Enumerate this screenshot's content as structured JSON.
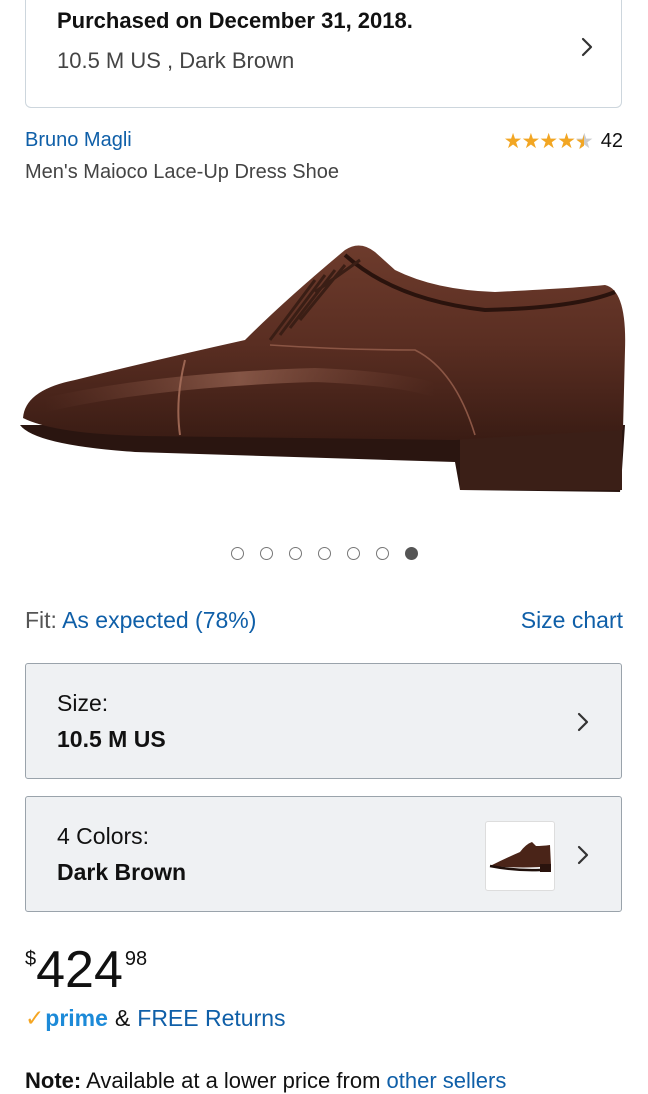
{
  "purchased": {
    "title": "Purchased on December 31, 2018.",
    "detail": "10.5 M US , Dark Brown"
  },
  "product": {
    "brand": "Bruno Magli",
    "title": "Men's Maioco Lace-Up Dress Shoe",
    "rating_count": "42",
    "rating_stars": 4.5
  },
  "carousel": {
    "dot_count": 7,
    "active_index": 6
  },
  "fit": {
    "label": "Fit:",
    "value": "As expected (78%)",
    "size_chart_link": "Size chart"
  },
  "size_selector": {
    "label": "Size:",
    "value": "10.5 M US"
  },
  "color_selector": {
    "label": "4 Colors:",
    "value": "Dark Brown"
  },
  "price": {
    "currency": "$",
    "whole": "424",
    "fraction": "98"
  },
  "shipping": {
    "prime_logo": "prime",
    "conjunction": "&",
    "returns": "FREE Returns"
  },
  "note": {
    "lead": "Note:",
    "text": " Available at a lower price from ",
    "link": "other sellers"
  },
  "colors": {
    "link": "#0f5fa8",
    "star": "#f2a623",
    "prime": "#1c8ad8"
  },
  "icons": [
    "chevron-right-icon",
    "star-icon",
    "prime-check-icon"
  ]
}
